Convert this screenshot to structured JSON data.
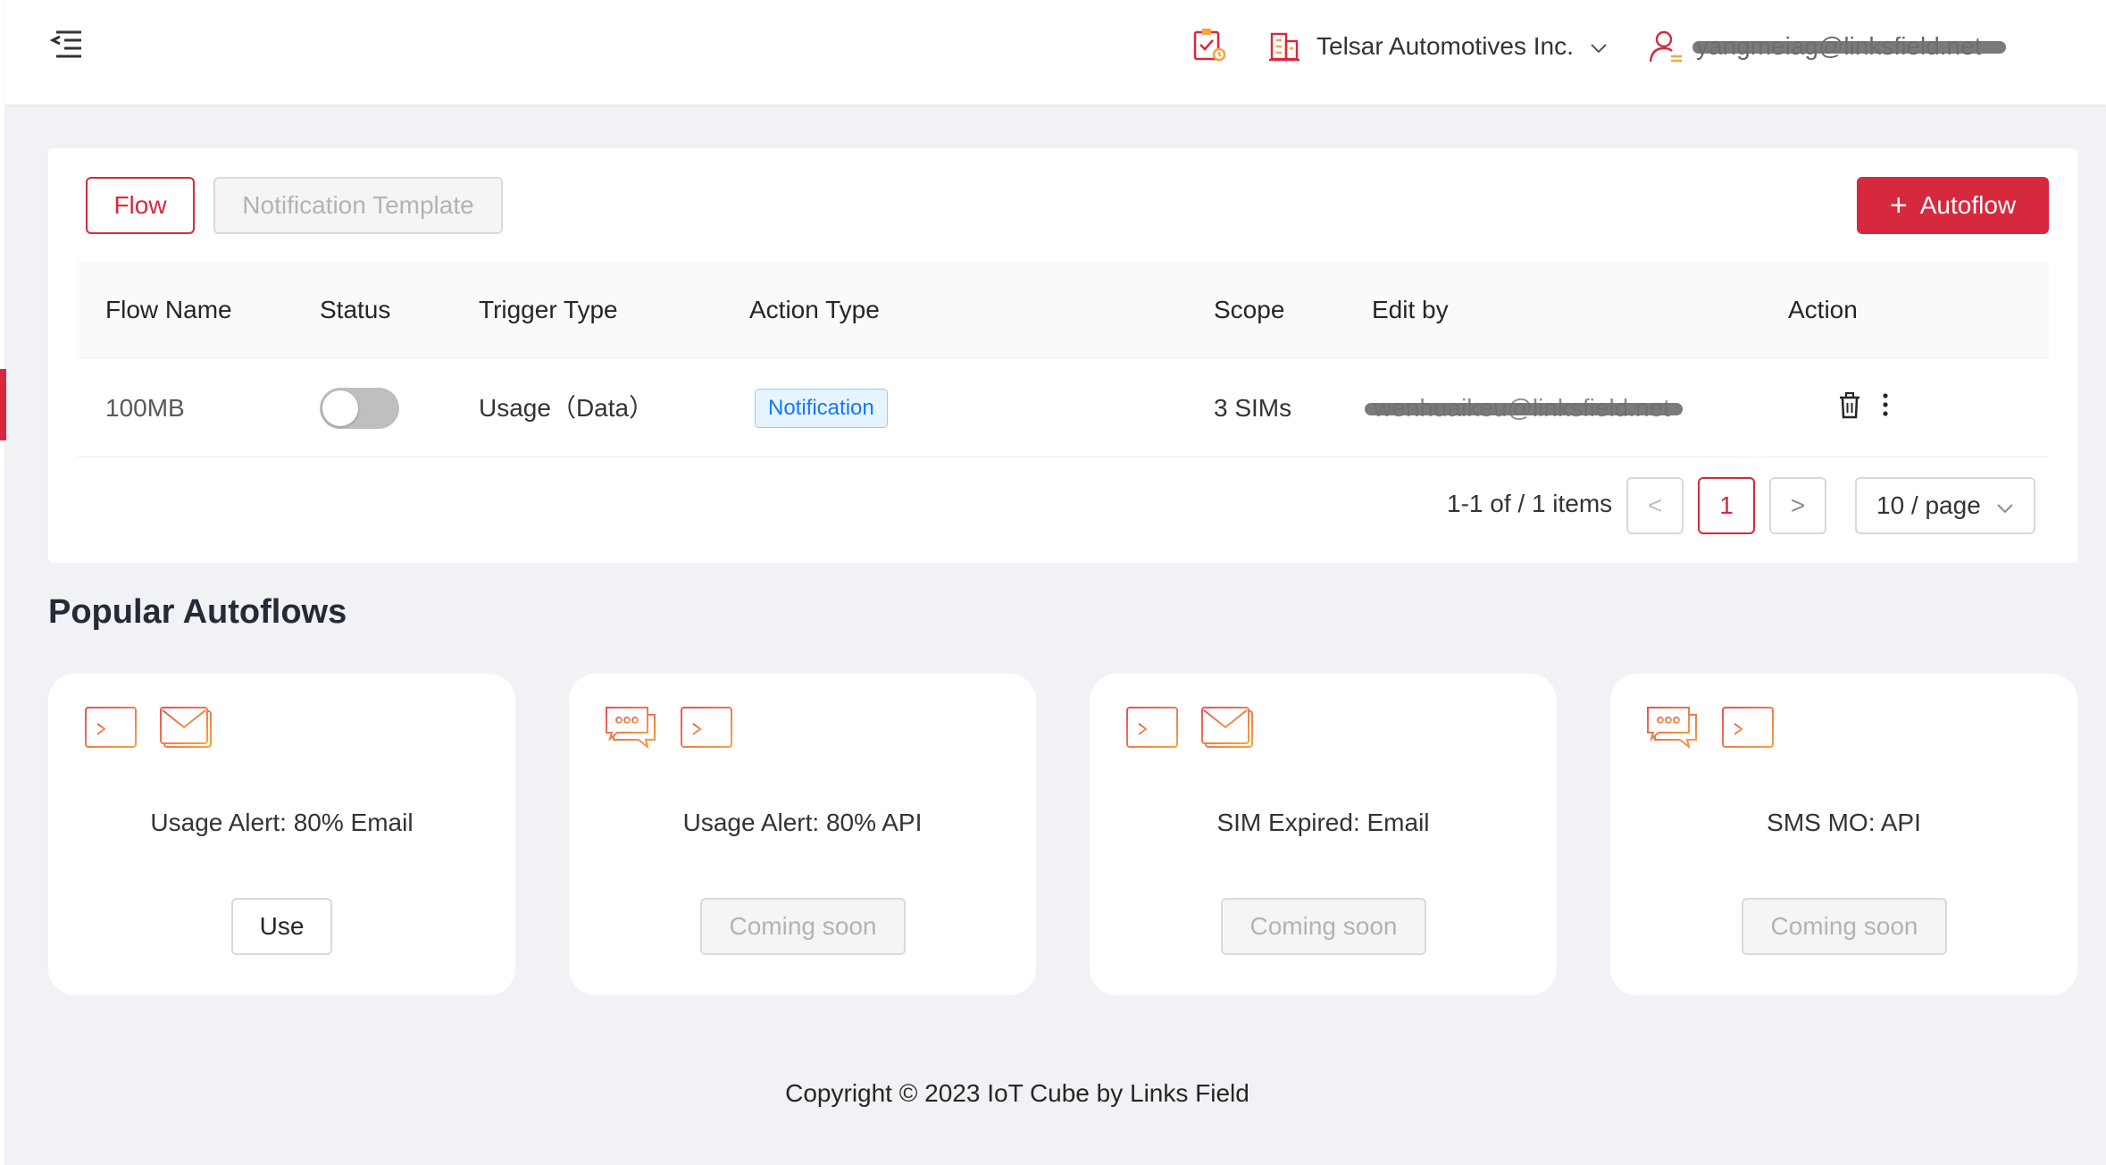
{
  "header": {
    "menu_icon": "menu-fold-icon",
    "task_icon": "clipboard-check-icon",
    "company_icon": "building-icon",
    "company_name": "Telsar Automotives Inc.",
    "user_icon": "user-icon",
    "user_email": "yangmeiag@linksfield.net"
  },
  "tabs": {
    "flow": "Flow",
    "template": "Notification Template"
  },
  "autoflow_button": {
    "plus": "+",
    "label": "Autoflow"
  },
  "table": {
    "columns": [
      "Flow Name",
      "Status",
      "Trigger Type",
      "Action Type",
      "Scope",
      "Edit by",
      "Action"
    ],
    "rows": [
      {
        "flow_name": "100MB",
        "status": "off",
        "trigger_type": "Usage（Data）",
        "action_type": "Notification",
        "scope": "3 SIMs",
        "edit_by": "wenhuaikeu@linksfield.net"
      }
    ]
  },
  "pagination": {
    "total": "1-1 of / 1 items",
    "prev": "<",
    "page": "1",
    "next": ">",
    "page_size": "10 / page"
  },
  "popular": {
    "title": "Popular Autoflows",
    "cards": [
      {
        "title": "Usage Alert: 80% Email",
        "button": "Use",
        "icons": [
          "terminal-icon",
          "email-icon"
        ]
      },
      {
        "title": "Usage Alert: 80% API",
        "button": "Coming soon",
        "icons": [
          "chat-icon",
          "terminal-icon"
        ]
      },
      {
        "title": "SIM Expired: Email",
        "button": "Coming soon",
        "icons": [
          "terminal-icon",
          "email-icon"
        ]
      },
      {
        "title": "SMS MO: API",
        "button": "Coming soon",
        "icons": [
          "chat-icon",
          "terminal-icon"
        ]
      }
    ]
  },
  "footer": "Copyright © 2023 IoT Cube by Links Field",
  "colors": {
    "brand": "#d6293e",
    "icon_gradient_start": "#e8505b",
    "icon_gradient_end": "#f4a340",
    "badge": "#1677ff"
  }
}
